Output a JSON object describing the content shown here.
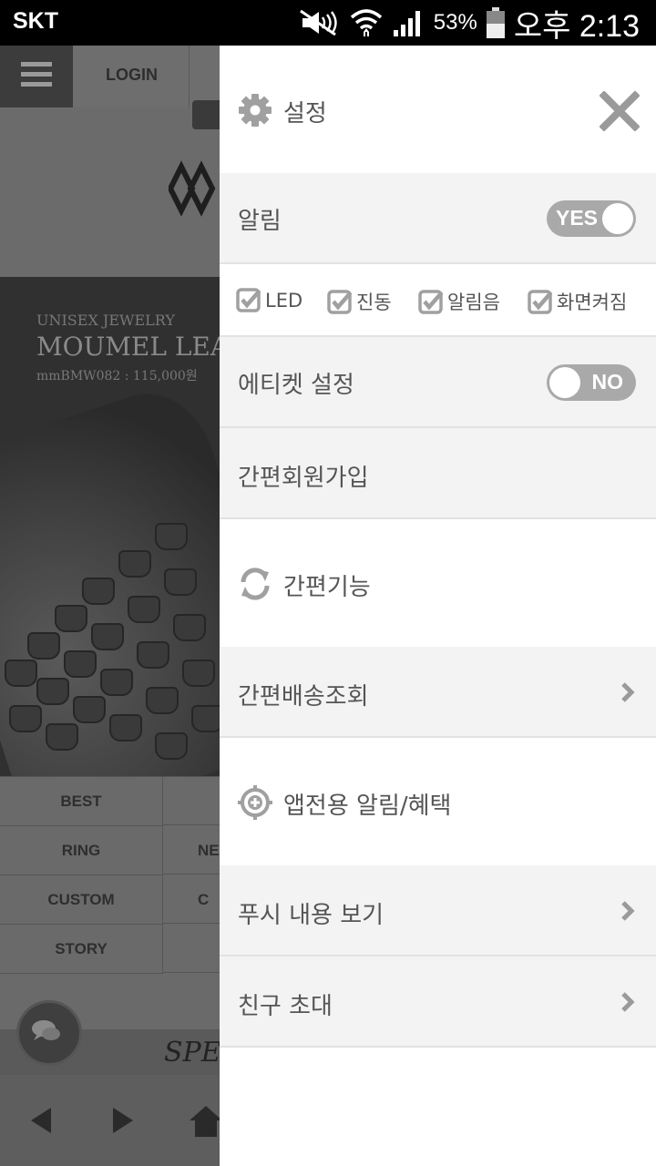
{
  "status_bar": {
    "carrier": "SKT",
    "battery": "53%",
    "time": "오후 2:13"
  },
  "background_page": {
    "login_label": "LOGIN",
    "banner_line1": "UNISEX JEWELRY",
    "banner_line2": "MOUMEL LEATH",
    "banner_line3": "mmBMW082 : 115,000원",
    "categories": [
      "BEST",
      "RING",
      "CUSTOM",
      "STORY"
    ],
    "categories_right": [
      "",
      "NE",
      "C",
      ""
    ],
    "promo_text": "SPE"
  },
  "drawer": {
    "title": "설정",
    "notification": {
      "label": "알림",
      "toggle_text": "YES",
      "toggle_on": true
    },
    "checkboxes": [
      {
        "label": "LED",
        "checked": true
      },
      {
        "label": "진동",
        "checked": true
      },
      {
        "label": "알림음",
        "checked": true
      },
      {
        "label": "화면켜짐",
        "checked": true
      }
    ],
    "etiquette": {
      "label": "에티켓 설정",
      "toggle_text": "NO",
      "toggle_on": false
    },
    "signup_label": "간편회원가입",
    "section_easy": "간편기능",
    "delivery_label": "간편배송조회",
    "section_app": "앱전용 알림/혜택",
    "push_label": "푸시 내용 보기",
    "invite_label": "친구 초대"
  },
  "colors": {
    "icon_grey": "#a0a0a0",
    "toggle_grey": "#a9a9a9",
    "row_grey": "#f3f3f3",
    "divider": "#e2e2e2"
  }
}
